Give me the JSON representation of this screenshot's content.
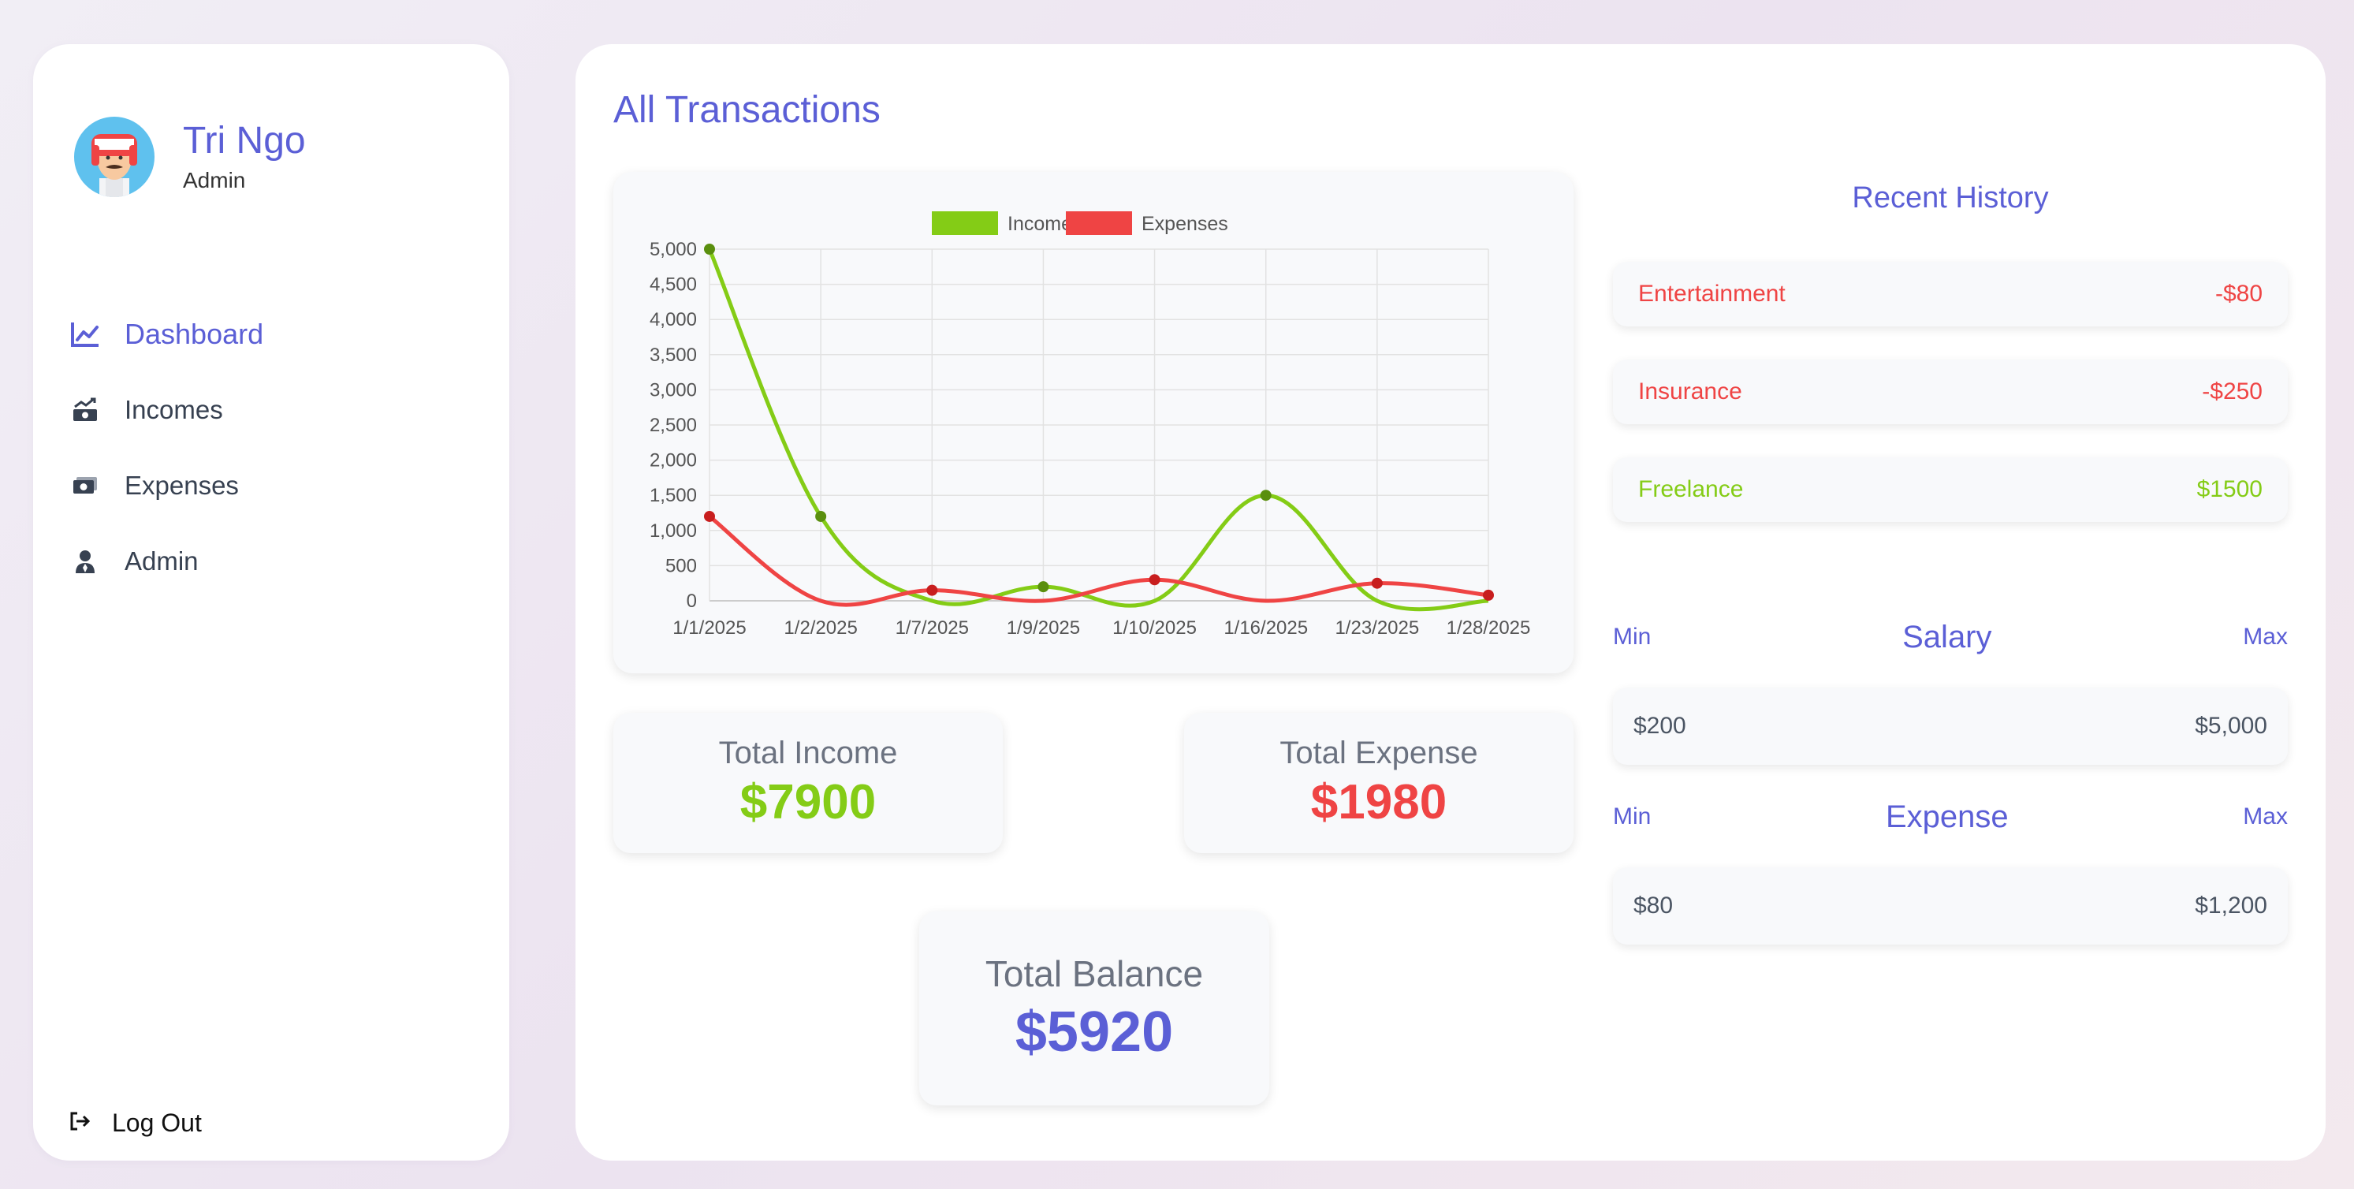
{
  "profile": {
    "name": "Tri Ngo",
    "role": "Admin"
  },
  "nav": {
    "items": [
      {
        "label": "Dashboard",
        "icon": "chart-line-icon"
      },
      {
        "label": "Incomes",
        "icon": "money-bill-trend-icon"
      },
      {
        "label": "Expenses",
        "icon": "money-bill-icon"
      },
      {
        "label": "Admin",
        "icon": "user-tie-icon"
      }
    ],
    "logout": "Log Out"
  },
  "main": {
    "title": "All Transactions"
  },
  "colors": {
    "accent": "#5b5fd6",
    "income": "#84cc16",
    "expense": "#ef4444",
    "muted": "#6b7280"
  },
  "chart_data": {
    "type": "line",
    "categories": [
      "1/1/2025",
      "1/2/2025",
      "1/7/2025",
      "1/9/2025",
      "1/10/2025",
      "1/16/2025",
      "1/23/2025",
      "1/28/2025"
    ],
    "series": [
      {
        "name": "Income",
        "color": "#84cc16",
        "values": [
          5000,
          1200,
          null,
          200,
          null,
          1500,
          null,
          null
        ]
      },
      {
        "name": "Expenses",
        "color": "#ef4444",
        "values": [
          1200,
          null,
          150,
          null,
          300,
          null,
          250,
          80
        ]
      }
    ],
    "ylim": [
      0,
      5000
    ],
    "yticks": [
      "0",
      "500",
      "1,000",
      "1,500",
      "2,000",
      "2,500",
      "3,000",
      "3,500",
      "4,000",
      "4,500",
      "5,000"
    ],
    "grid": true,
    "legend": "top"
  },
  "totals": {
    "income_label": "Total Income",
    "income_value": "$7900",
    "expense_label": "Total Expense",
    "expense_value": "$1980",
    "balance_label": "Total Balance",
    "balance_value": "$5920"
  },
  "recent": {
    "title": "Recent History",
    "items": [
      {
        "label": "Entertainment",
        "amount": "-$80",
        "type": "expense"
      },
      {
        "label": "Insurance",
        "amount": "-$250",
        "type": "expense"
      },
      {
        "label": "Freelance",
        "amount": "$1500",
        "type": "income"
      }
    ]
  },
  "salary": {
    "title": "Salary",
    "min_label": "Min",
    "max_label": "Max",
    "min": "$200",
    "max": "$5,000"
  },
  "expense_range": {
    "title": "Expense",
    "min_label": "Min",
    "max_label": "Max",
    "min": "$80",
    "max": "$1,200"
  }
}
